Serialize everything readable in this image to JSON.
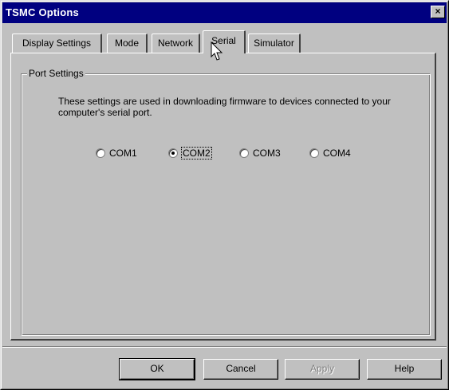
{
  "window": {
    "title": "TSMC Options"
  },
  "tabs": [
    {
      "label": "Display Settings"
    },
    {
      "label": "Mode"
    },
    {
      "label": "Network"
    },
    {
      "label": "Serial",
      "active": true
    },
    {
      "label": "Simulator"
    }
  ],
  "port_settings": {
    "group_label": "Port Settings",
    "description": "These settings are used in downloading firmware to devices connected to your computer's serial port.",
    "options": [
      {
        "label": "COM1",
        "selected": false
      },
      {
        "label": "COM2",
        "selected": true
      },
      {
        "label": "COM3",
        "selected": false
      },
      {
        "label": "COM4",
        "selected": false
      }
    ]
  },
  "buttons": {
    "ok": "OK",
    "cancel": "Cancel",
    "apply": "Apply",
    "help": "Help"
  }
}
